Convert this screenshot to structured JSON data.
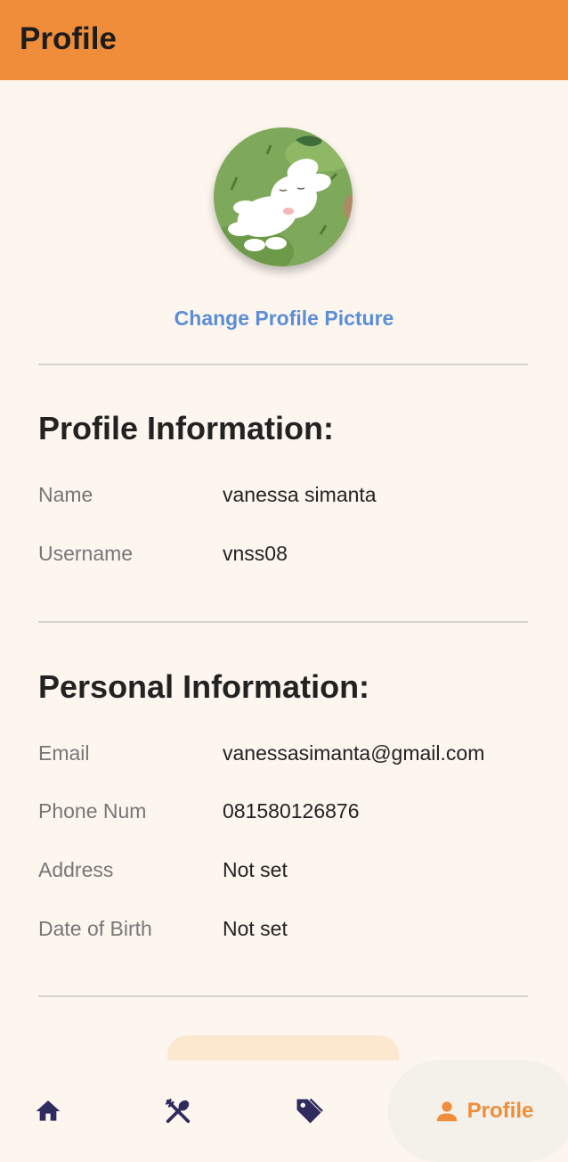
{
  "appbar": {
    "title": "Profile"
  },
  "avatar": {
    "alt": "profile-picture"
  },
  "change_picture_label": "Change Profile Picture",
  "profile_section": {
    "title": "Profile Information:",
    "rows": [
      {
        "label": "Name",
        "value": "vanessa simanta"
      },
      {
        "label": "Username",
        "value": "vnss08"
      }
    ]
  },
  "personal_section": {
    "title": "Personal Information:",
    "rows": [
      {
        "label": "Email",
        "value": "vanessasimanta@gmail.com"
      },
      {
        "label": "Phone Num",
        "value": "081580126876"
      },
      {
        "label": "Address",
        "value": "Not set"
      },
      {
        "label": "Date of Birth",
        "value": "Not set"
      }
    ]
  },
  "bottom_nav": {
    "items": [
      {
        "icon": "home-icon"
      },
      {
        "icon": "utensils-icon"
      },
      {
        "icon": "tag-icon"
      },
      {
        "icon": "person-icon",
        "label": "Profile",
        "active": true
      }
    ],
    "active_color": "#ef8d3a",
    "icon_color": "#2e2b5f"
  },
  "colors": {
    "appbar": "#ef8d3a",
    "link": "#5b8ed6",
    "background": "#fdf6ef"
  }
}
